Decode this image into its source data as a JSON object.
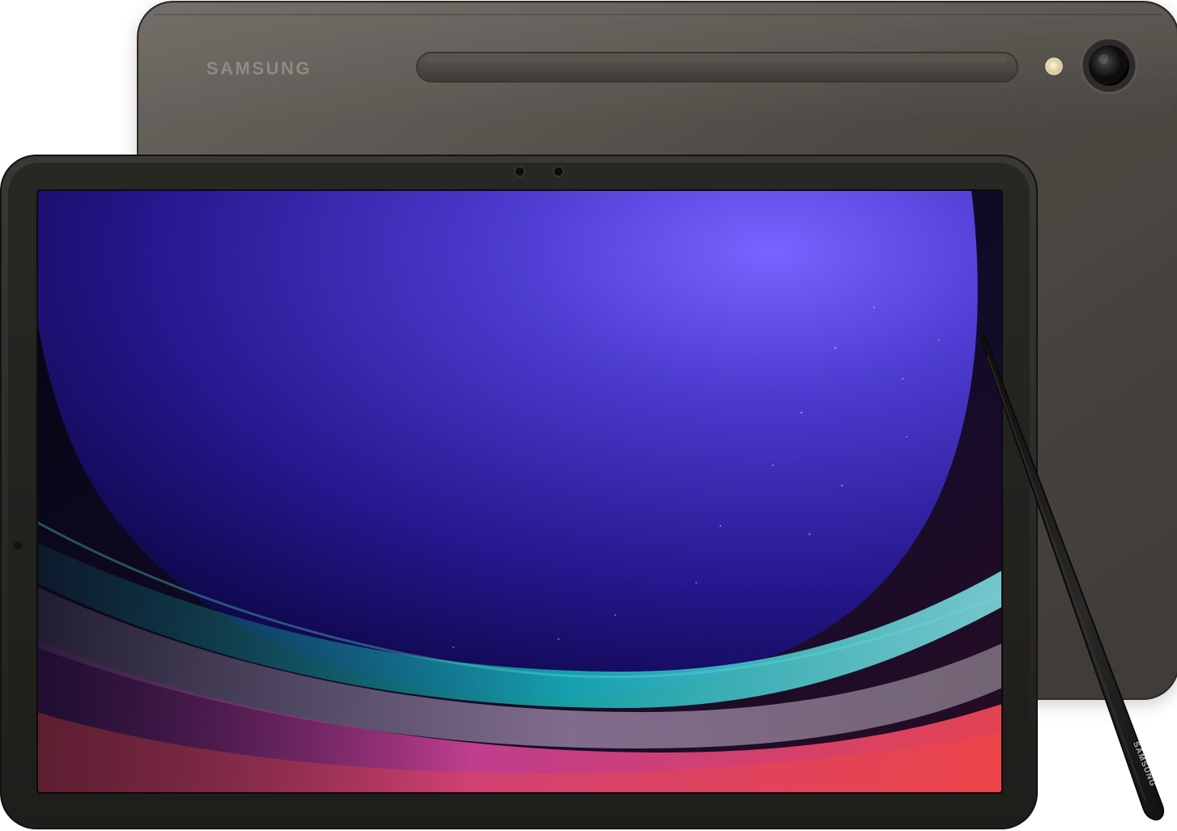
{
  "product": {
    "back_brand_text": "SAMSUNG",
    "pen_brand_text": "SAMSUNG",
    "colors": {
      "body_graphite": "#4b4742",
      "bezel": "#2a2927",
      "screen_blue": "#3d2aa0",
      "accent_teal": "#13b3b3",
      "accent_pink": "#ff5aa0",
      "pen": "#1c1b1a"
    }
  }
}
